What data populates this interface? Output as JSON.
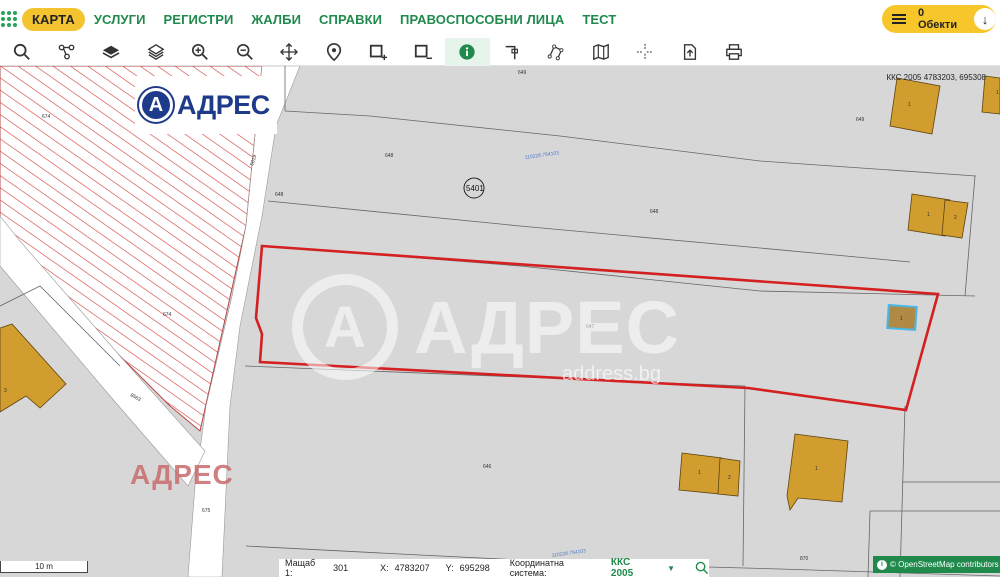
{
  "nav": {
    "items": [
      "КАРТА",
      "УСЛУГИ",
      "РЕГИСТРИ",
      "ЖАЛБИ",
      "СПРАВКИ",
      "ПРАВОСПОСОБНИ ЛИЦА",
      "ТЕСТ"
    ],
    "active": "КАРТА",
    "objects_label": "0 Обекти"
  },
  "toolbar": {
    "tools": [
      "search-icon",
      "node-network-icon",
      "layers-icon",
      "layers-outline-icon",
      "zoom-in-icon",
      "zoom-out-icon",
      "pan-icon",
      "location-pin-icon",
      "select-add-icon",
      "select-remove-icon",
      "info-icon",
      "measure-angle-icon",
      "polygon-icon",
      "map-icon",
      "crosshair-icon",
      "export-icon",
      "print-icon"
    ],
    "active_tool": "info-icon"
  },
  "map": {
    "coord_readout": "ККС 2005 4783203, 695308",
    "logo_text": "АДРЕС",
    "watermark_text": "АДРЕС",
    "watermark_url": "address.bg",
    "watermark_red": "АДРЕС",
    "parcel_ids": [
      "674",
      "674",
      "649",
      "648",
      "648",
      "649",
      "5619",
      "5401",
      "648",
      "647",
      "8563",
      "646",
      "875",
      "675",
      "870"
    ],
    "building_labels": [
      "1",
      "1",
      "1",
      "2",
      "1",
      "1",
      "1",
      "2",
      "1",
      "3",
      "1"
    ],
    "cadastral_refs": [
      "11022б.754103",
      "11022б.754103"
    ],
    "selected_parcel": "647",
    "highlight_color": "#d42020",
    "selected_building_color": "#48b8e8"
  },
  "status": {
    "scale_label": "Мащаб 1:",
    "scale_value": "301",
    "x_label": "X:",
    "x_value": "4783207",
    "y_label": "Y:",
    "y_value": "695298",
    "system_label": "Координатна система:",
    "system_value": "ККС 2005",
    "dropdown_arrow": "▼"
  },
  "scalebar": "10 m",
  "attribution": "© OpenStreetMap contributors"
}
